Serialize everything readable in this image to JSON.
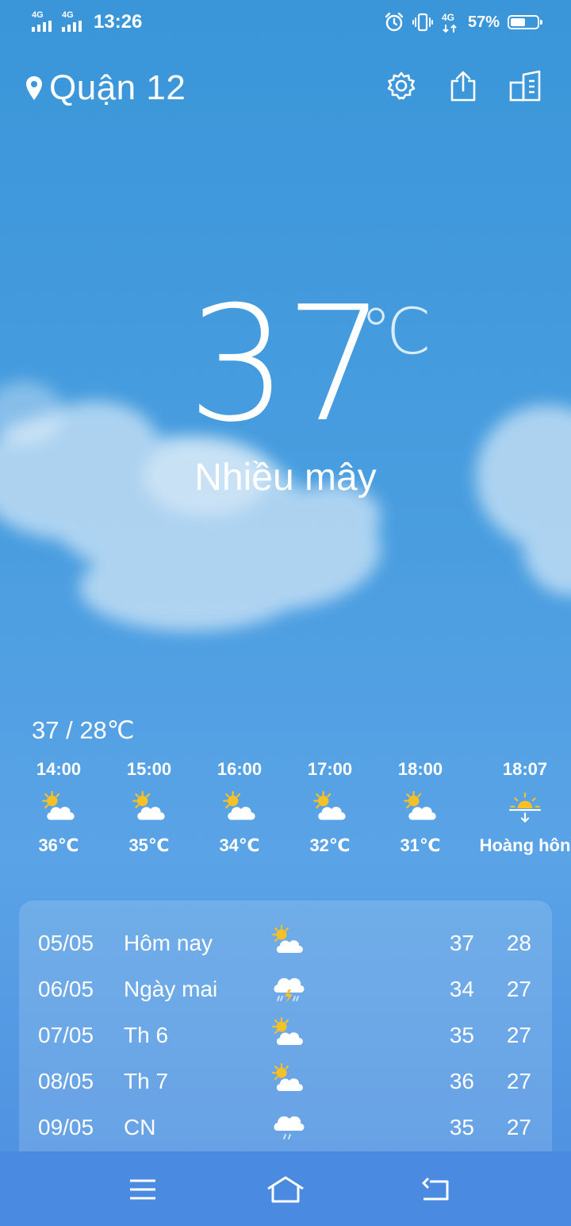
{
  "status_bar": {
    "sim1": "4G",
    "sim2": "4G",
    "time": "13:26",
    "data_type": "4G",
    "battery_percent": "57%",
    "battery_level": 0.57,
    "icons": [
      "alarm-icon",
      "vibrate-icon",
      "mobile-data-icon",
      "battery-icon"
    ]
  },
  "header": {
    "location": "Quận 12",
    "icons": [
      "location-pin-icon",
      "settings-gear-icon",
      "share-icon",
      "city-list-icon"
    ]
  },
  "current": {
    "temperature": "37",
    "unit": "℃",
    "condition": "Nhiều mây"
  },
  "hourly": {
    "range": "37 / 28℃",
    "items": [
      {
        "time": "14:00",
        "icon": "partly-cloudy-icon",
        "value": "36℃"
      },
      {
        "time": "15:00",
        "icon": "partly-cloudy-icon",
        "value": "35℃"
      },
      {
        "time": "16:00",
        "icon": "partly-cloudy-icon",
        "value": "34℃"
      },
      {
        "time": "17:00",
        "icon": "partly-cloudy-icon",
        "value": "32℃"
      },
      {
        "time": "18:00",
        "icon": "partly-cloudy-icon",
        "value": "31℃"
      },
      {
        "time": "18:07",
        "icon": "sunset-icon",
        "value": "Hoàng hôn"
      }
    ]
  },
  "daily": [
    {
      "date": "05/05",
      "name": "Hôm nay",
      "icon": "partly-cloudy-icon",
      "high": "37",
      "low": "28"
    },
    {
      "date": "06/05",
      "name": "Ngày mai",
      "icon": "thunderstorm-icon",
      "high": "34",
      "low": "27"
    },
    {
      "date": "07/05",
      "name": "Th 6",
      "icon": "partly-cloudy-icon",
      "high": "35",
      "low": "27"
    },
    {
      "date": "08/05",
      "name": "Th 7",
      "icon": "partly-cloudy-icon",
      "high": "36",
      "low": "27"
    },
    {
      "date": "09/05",
      "name": "CN",
      "icon": "rain-icon",
      "high": "35",
      "low": "27"
    }
  ],
  "nav_bar": {
    "icons": [
      "menu-icon",
      "home-icon",
      "back-icon"
    ]
  },
  "colors": {
    "background_top": "#3a96d9",
    "background_bottom": "#4d8fe0",
    "sun": "#f5c028",
    "cloud": "#ffffff"
  }
}
